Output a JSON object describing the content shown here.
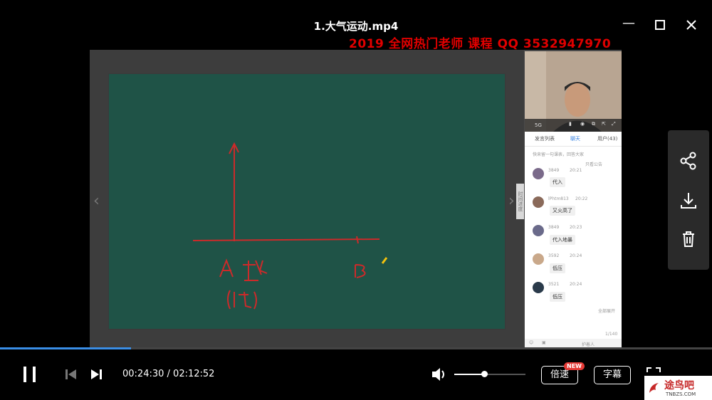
{
  "window": {
    "title": "1.大气运动.mp4",
    "minimize_label": "—",
    "maximize_label": "☐",
    "close_label": "✕"
  },
  "watermark": "2019 全网热门老师 课程 QQ 3532947970",
  "board": {
    "strokes_color": "#cc2a2a",
    "label_a": "A",
    "label_a_char": "热",
    "label_a_sub": "(低)",
    "label_b": "B"
  },
  "stage": {
    "side_tab_label": "时间进度"
  },
  "chat": {
    "cam_label": "5G",
    "tabs": [
      "发言列表",
      "聊天",
      "用户(43)"
    ],
    "notice": "快来留一句课表，回答大家",
    "filter_label": "只看公告",
    "messages": [
      {
        "name": "3849",
        "time": "20:21",
        "text": "代入"
      },
      {
        "name": "lPhtm813",
        "time": "20:22",
        "text": "又火高了"
      },
      {
        "name": "3849",
        "time": "20:23",
        "text": "代入地暴"
      },
      {
        "name": "3592",
        "time": "20:24",
        "text": "低压"
      },
      {
        "name": "3521",
        "time": "20:24",
        "text": "低压"
      }
    ],
    "footer_action": "全部展开",
    "page_count": "1/140",
    "input_label": "护着人"
  },
  "player": {
    "current_time": "00:24:30",
    "separator": " / ",
    "total_time": "02:12:52",
    "progress": 0.184,
    "volume": 0.42,
    "speed_label": "倍速",
    "new_badge": "NEW",
    "subtitle_label": "字幕",
    "accent_color": "#3a8ee6"
  },
  "logo": {
    "text": "途鸟吧",
    "sub": "TNBZS.COM"
  }
}
